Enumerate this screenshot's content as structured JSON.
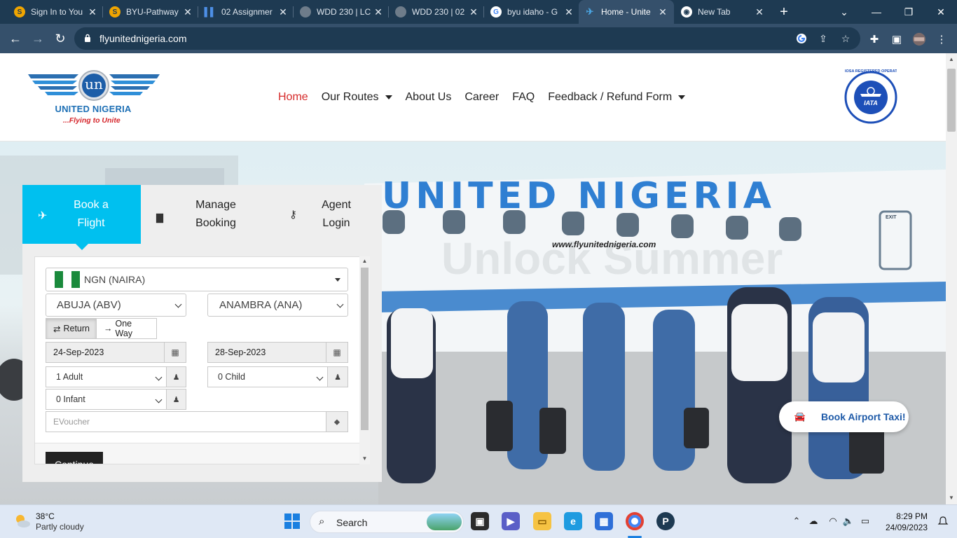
{
  "browser": {
    "tabs": [
      {
        "title": "Sign In to You",
        "favicon_color": "#f0a500"
      },
      {
        "title": "BYU-Pathway",
        "favicon_color": "#f0a500"
      },
      {
        "title": "02 Assignmer",
        "favicon_color": "#2f6fd6"
      },
      {
        "title": "WDD 230 | LC",
        "favicon_color": "#9aa3ad"
      },
      {
        "title": "WDD 230 | 02",
        "favicon_color": "#9aa3ad"
      },
      {
        "title": "byu idaho - G",
        "favicon_color": "#ffffff"
      },
      {
        "title": "Home - Unite",
        "favicon_color": "#4aa3df",
        "active": true
      },
      {
        "title": "New Tab",
        "favicon_color": "#ffffff"
      }
    ],
    "url": "flyunitednigeria.com"
  },
  "site": {
    "logo_name": "UNITED NIGERIA",
    "logo_slogan": "...Flying to Unite",
    "logo_mark": "un",
    "nav": [
      {
        "label": "Home",
        "active": true,
        "dropdown": false
      },
      {
        "label": "Our Routes",
        "active": false,
        "dropdown": true
      },
      {
        "label": "About Us",
        "active": false,
        "dropdown": false
      },
      {
        "label": "Career",
        "active": false,
        "dropdown": false
      },
      {
        "label": "FAQ",
        "active": false,
        "dropdown": false
      },
      {
        "label": "Feedback / Refund Form",
        "active": false,
        "dropdown": true
      }
    ],
    "badge_text": "IATA",
    "badge_ring_text": "IOSA REGISTERED OPERATOR"
  },
  "hero": {
    "fuselage_text": "UNITED NIGERIA",
    "fuselage_url": "www.flyunitednigeria.com",
    "watermark": "Unlock Summer",
    "aircraft_mark": "EXIT"
  },
  "booking": {
    "tabs": [
      {
        "label_line1": "Book a",
        "label_line2": "Flight",
        "icon": "plane-icon",
        "active": true
      },
      {
        "label_line1": "Manage",
        "label_line2": "Booking",
        "icon": "briefcase-icon",
        "active": false
      },
      {
        "label_line1": "Agent",
        "label_line2": "Login",
        "icon": "key-icon",
        "active": false
      }
    ],
    "currency": "NGN (NAIRA)",
    "origin": "ABUJA (ABV)",
    "destination": "ANAMBRA (ANA)",
    "trip_return": "Return",
    "trip_oneway": "One Way",
    "depart_date": "24-Sep-2023",
    "return_date": "28-Sep-2023",
    "adults": "1 Adult",
    "children": "0 Child",
    "infants": "0 Infant",
    "voucher_placeholder": "EVoucher",
    "continue_label": "Continue",
    "accent_color": "#00c0ef"
  },
  "taxi_button": "Book Airport Taxi!",
  "taskbar": {
    "temperature": "38°C",
    "weather": "Partly cloudy",
    "search_label": "Search",
    "time": "8:29 PM",
    "date": "24/09/2023"
  }
}
